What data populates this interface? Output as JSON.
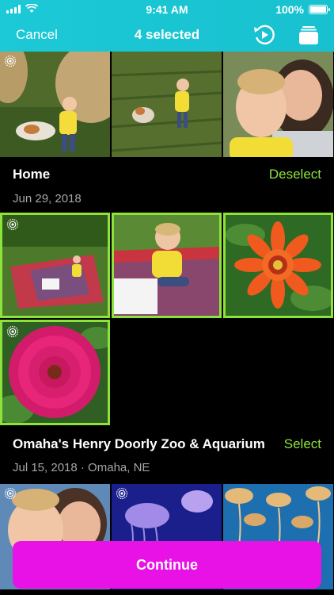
{
  "status": {
    "time": "9:41 AM",
    "battery": "100%"
  },
  "nav": {
    "cancel_label": "Cancel",
    "title": "4 selected",
    "play_icon": "play-cycle-icon",
    "album_icon": "album-stack-icon"
  },
  "sections": [
    {
      "title": "Home",
      "date": "Jun 29, 2018",
      "action": "Deselect"
    },
    {
      "title": "Omaha's Henry Doorly Zoo & Aquarium",
      "date": "Jul 15, 2018  ·  Omaha, NE",
      "action": "Select"
    }
  ],
  "photos": {
    "top_row": [
      "boy-with-dog-by-hay-bale",
      "boy-and-dog-in-garden",
      "boy-and-mom-selfie"
    ],
    "home_row1": [
      "picnic-blanket-wide",
      "boy-coloring-on-blanket",
      "orange-zinnia"
    ],
    "home_row2": [
      "pink-dahlia"
    ],
    "zoo_row": [
      "boy-and-mom-at-zoo",
      "jellyfish-purple",
      "jellyfish-orange"
    ]
  },
  "continue_label": "Continue",
  "colors": {
    "header": "#1cc9d6",
    "accent": "#8ee33a",
    "button": "#e912e6"
  }
}
